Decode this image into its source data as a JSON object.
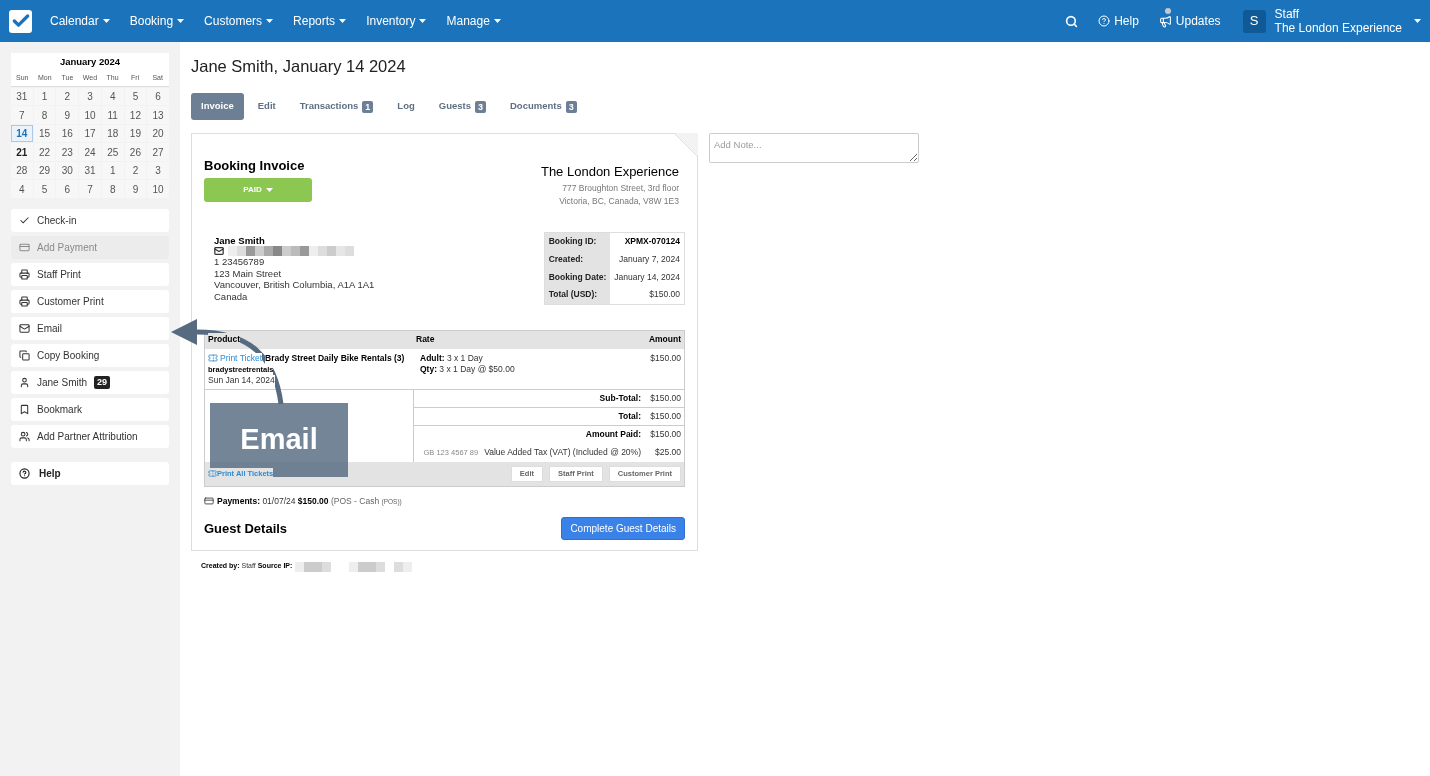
{
  "nav": {
    "menus": [
      "Calendar",
      "Booking",
      "Customers",
      "Reports",
      "Inventory",
      "Manage"
    ],
    "help": "Help",
    "updates": "Updates",
    "user": {
      "initial": "S",
      "role": "Staff",
      "company": "The London Experience"
    }
  },
  "calendar": {
    "title": "January 2024",
    "weekdays": [
      "Sun",
      "Mon",
      "Tue",
      "Wed",
      "Thu",
      "Fri",
      "Sat"
    ],
    "weeks": [
      [
        {
          "day": "31",
          "selected": false,
          "today": false
        },
        {
          "day": "1",
          "selected": false,
          "today": false
        },
        {
          "day": "2",
          "selected": false,
          "today": false
        },
        {
          "day": "3",
          "selected": false,
          "today": false
        },
        {
          "day": "4",
          "selected": false,
          "today": false
        },
        {
          "day": "5",
          "selected": false,
          "today": false
        },
        {
          "day": "6",
          "selected": false,
          "today": false
        }
      ],
      [
        {
          "day": "7",
          "selected": false,
          "today": false
        },
        {
          "day": "8",
          "selected": false,
          "today": false
        },
        {
          "day": "9",
          "selected": false,
          "today": false
        },
        {
          "day": "10",
          "selected": false,
          "today": false
        },
        {
          "day": "11",
          "selected": false,
          "today": false
        },
        {
          "day": "12",
          "selected": false,
          "today": false
        },
        {
          "day": "13",
          "selected": false,
          "today": false
        }
      ],
      [
        {
          "day": "14",
          "selected": true,
          "today": false
        },
        {
          "day": "15",
          "selected": false,
          "today": false
        },
        {
          "day": "16",
          "selected": false,
          "today": false
        },
        {
          "day": "17",
          "selected": false,
          "today": false
        },
        {
          "day": "18",
          "selected": false,
          "today": false
        },
        {
          "day": "19",
          "selected": false,
          "today": false
        },
        {
          "day": "20",
          "selected": false,
          "today": false
        }
      ],
      [
        {
          "day": "21",
          "selected": false,
          "today": true
        },
        {
          "day": "22",
          "selected": false,
          "today": false
        },
        {
          "day": "23",
          "selected": false,
          "today": false
        },
        {
          "day": "24",
          "selected": false,
          "today": false
        },
        {
          "day": "25",
          "selected": false,
          "today": false
        },
        {
          "day": "26",
          "selected": false,
          "today": false
        },
        {
          "day": "27",
          "selected": false,
          "today": false
        }
      ],
      [
        {
          "day": "28",
          "selected": false,
          "today": false
        },
        {
          "day": "29",
          "selected": false,
          "today": false
        },
        {
          "day": "30",
          "selected": false,
          "today": false
        },
        {
          "day": "31",
          "selected": false,
          "today": false
        },
        {
          "day": "1",
          "selected": false,
          "today": false
        },
        {
          "day": "2",
          "selected": false,
          "today": false
        },
        {
          "day": "3",
          "selected": false,
          "today": false
        }
      ],
      [
        {
          "day": "4",
          "selected": false,
          "today": false
        },
        {
          "day": "5",
          "selected": false,
          "today": false
        },
        {
          "day": "6",
          "selected": false,
          "today": false
        },
        {
          "day": "7",
          "selected": false,
          "today": false
        },
        {
          "day": "8",
          "selected": false,
          "today": false
        },
        {
          "day": "9",
          "selected": false,
          "today": false
        },
        {
          "day": "10",
          "selected": false,
          "today": false
        }
      ]
    ]
  },
  "sidebar": {
    "actions": [
      {
        "label": "Check-in",
        "disabled": false
      },
      {
        "label": "Add Payment",
        "disabled": true
      },
      {
        "label": "Staff Print",
        "disabled": false
      },
      {
        "label": "Customer Print",
        "disabled": false
      },
      {
        "label": "Email",
        "disabled": false
      },
      {
        "label": "Copy Booking",
        "disabled": false
      },
      {
        "label": "Jane Smith",
        "disabled": false,
        "badge": "29"
      },
      {
        "label": "Bookmark",
        "disabled": false
      },
      {
        "label": "Add Partner Attribution",
        "disabled": false
      }
    ],
    "help": "Help"
  },
  "page_title": "Jane Smith, January 14 2024",
  "tabs": [
    {
      "label": "Invoice",
      "selected": true
    },
    {
      "label": "Edit",
      "selected": false
    },
    {
      "label": "Transactions",
      "count": "1",
      "selected": false
    },
    {
      "label": "Log",
      "selected": false
    },
    {
      "label": "Guests",
      "count": "3",
      "selected": false
    },
    {
      "label": "Documents",
      "count": "3",
      "selected": false
    }
  ],
  "invoice": {
    "title": "Booking Invoice",
    "status": "PAID",
    "company": "The London Experience",
    "company_address": [
      "777 Broughton Street, 3rd floor",
      "Victoria, BC, Canada, V8W 1E3"
    ],
    "customer": {
      "name": "Jane Smith",
      "phone": "1 23456789",
      "address": [
        "123 Main Street",
        "Vancouver, British Columbia, A1A 1A1",
        "Canada"
      ]
    },
    "details": [
      {
        "label": "Booking ID:",
        "value": "XPMX-070124"
      },
      {
        "label": "Created:",
        "value": "January 7, 2024"
      },
      {
        "label": "Booking Date:",
        "value": "January 14, 2024"
      },
      {
        "label": "Total (USD):",
        "value": "$150.00"
      }
    ],
    "columns": [
      "Product",
      "Rate",
      "Amount"
    ],
    "item": {
      "print_link": "Print Ticket",
      "product": "Brady Street Daily Bike Rentals (3)",
      "vendor": "bradystreetrentals",
      "date": "Sun Jan 14, 2024",
      "rate_lines": [
        {
          "label": "Adult:",
          "value": "3 x 1 Day"
        },
        {
          "label": "Qty:",
          "value": "3 x 1 Day @ $50.00"
        }
      ],
      "amount": "$150.00"
    },
    "totals": [
      {
        "label": "Sub-Total:",
        "value": "$150.00"
      },
      {
        "label": "Total:",
        "value": "$150.00"
      },
      {
        "label": "Amount Paid:",
        "value": "$150.00"
      }
    ],
    "tax": {
      "number": "GB 123 4567 89",
      "label": "Value Added Tax (VAT) (Included @ 20%)",
      "value": "$25.00"
    },
    "print_all": "Print All Tickets",
    "footer_buttons": [
      "Edit",
      "Staff Print",
      "Customer Print"
    ],
    "payments": {
      "label": "Payments:",
      "date": "01/07/24",
      "amount": "$150.00",
      "method": "(POS - Cash",
      "source": "(POS))"
    },
    "guest_title": "Guest Details",
    "guest_button": "Complete Guest Details"
  },
  "created_by": {
    "label": "Created by:",
    "who": "Staff",
    "ip_label": "Source IP:"
  },
  "note": {
    "placeholder": "Add Note..."
  },
  "callout": {
    "label": "Email"
  }
}
